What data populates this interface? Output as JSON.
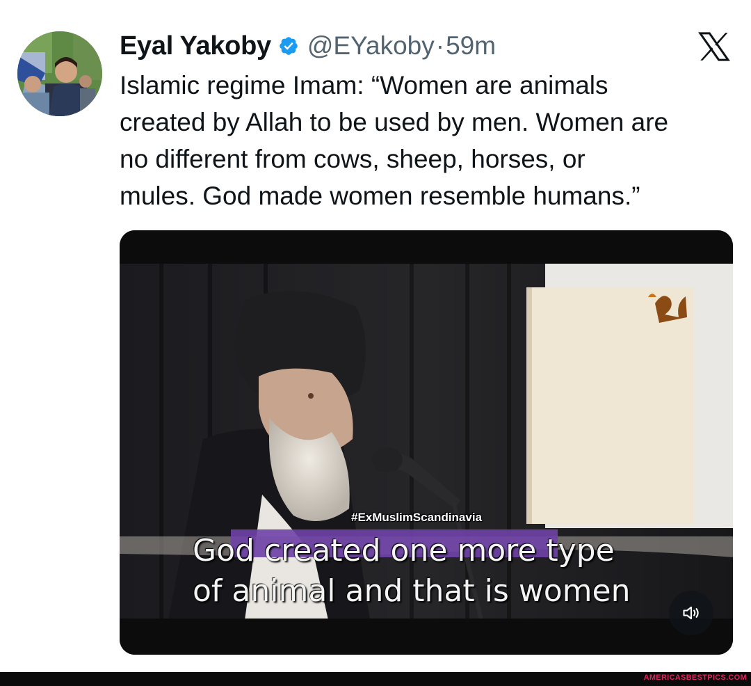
{
  "tweet": {
    "author": {
      "name": "Eyal Yakoby",
      "handle": "@EYakoby",
      "separator": "·",
      "time": "59m",
      "verified": true
    },
    "text_lines": [
      "Islamic regime Imam: “Women are animals",
      "created by Allah to be used by men. Women are",
      "no different from cows, sheep, horses, or",
      "mules. God made women resemble humans.”"
    ],
    "media": {
      "type": "video",
      "hashtag": "#ExMuslimScandinavia",
      "subtitle_lines": [
        "God created one more type",
        "of animal and that is women"
      ],
      "channel_logo_text": "ارجعيه",
      "controls": {
        "mute_icon": "speaker-muted-icon"
      }
    }
  },
  "platform": {
    "logo": "x-logo-icon"
  },
  "watermark": "AMERICASBESTPICS.COM",
  "colors": {
    "text": "#0f1419",
    "secondary": "#536471",
    "verified": "#1d9bf0",
    "watermark": "#e0245e"
  }
}
